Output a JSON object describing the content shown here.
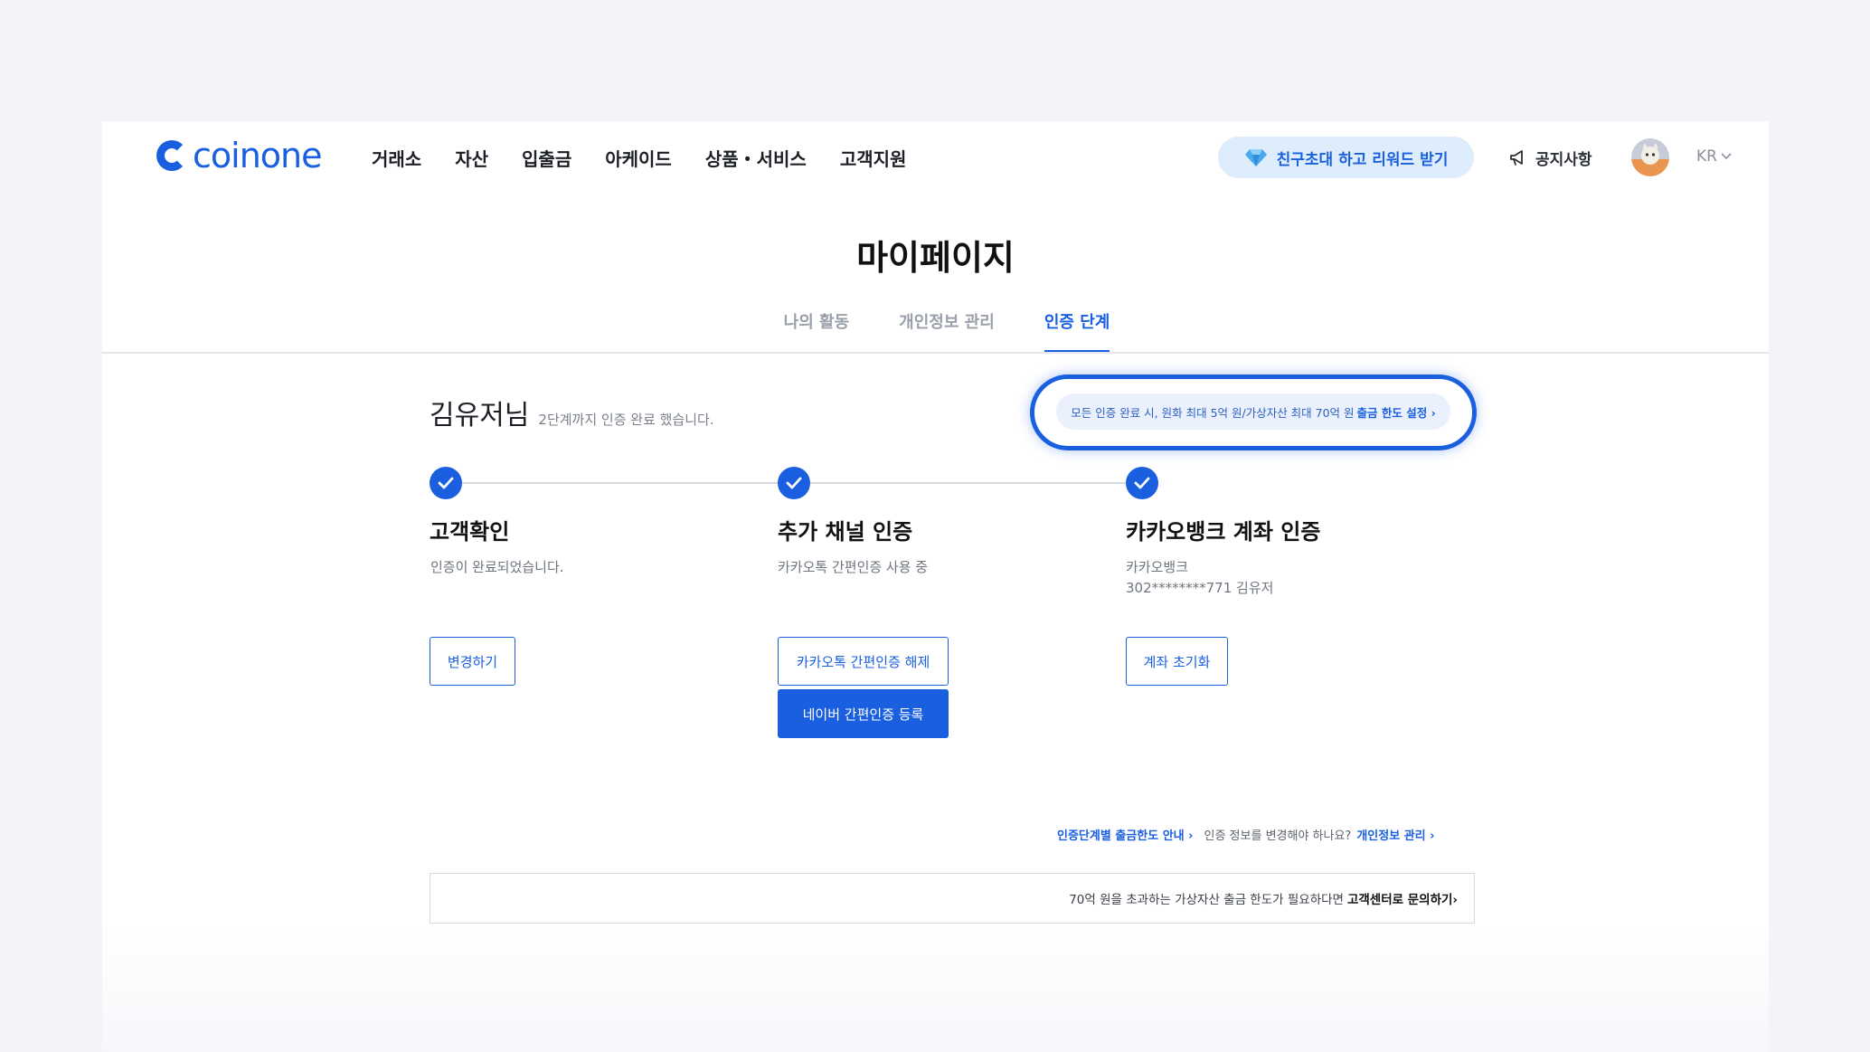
{
  "header": {
    "logo_text": "coinone",
    "nav": [
      "거래소",
      "자산",
      "입출금",
      "아케이드",
      "상품・서비스",
      "고객지원"
    ],
    "invite_label": "친구초대 하고 리워드 받기",
    "notice_label": "공지사항",
    "lang": "KR"
  },
  "page": {
    "title": "마이페이지",
    "tabs": [
      {
        "label": "나의 활동",
        "active": false
      },
      {
        "label": "개인정보 관리",
        "active": false
      },
      {
        "label": "인증 단계",
        "active": true
      }
    ]
  },
  "greeting": {
    "name": "김유저님",
    "status": "2단계까지 인증 완료 했습니다."
  },
  "limit_banner": {
    "text": "모든 인증 완료 시, 원화 최대 5억 원/가상자산 최대  70억 원",
    "link": "출금 한도 설정 ›"
  },
  "steps": [
    {
      "title": "고객확인",
      "desc_line1": "인증이 완료되었습니다.",
      "desc_line2": "",
      "buttons": [
        "변경하기"
      ]
    },
    {
      "title": "추가 채널 인증",
      "desc_line1": "카카오톡 간편인증 사용 중",
      "desc_line2": "",
      "buttons": [
        "카카오톡 간편인증 해제",
        "네이버 간편인증 등록"
      ]
    },
    {
      "title": "카카오뱅크 계좌 인증",
      "desc_line1": "카카오뱅크",
      "desc_line2": "302********771 김유저",
      "buttons": [
        "계좌 초기화"
      ]
    }
  ],
  "info_links": {
    "limit_guide": "인증단계별 출금한도 안내 ›",
    "question": "인증 정보를 변경해야 하나요?",
    "profile_link": "개인정보 관리 ›"
  },
  "bottom_notice": {
    "text": "70억 원을 초과하는 가상자산 출금 한도가 필요하다면",
    "link": "고객센터로 문의하기›"
  },
  "colors": {
    "accent": "#1a5fe0",
    "background": "#f2f4f8",
    "pill_bg": "#deedfb"
  }
}
